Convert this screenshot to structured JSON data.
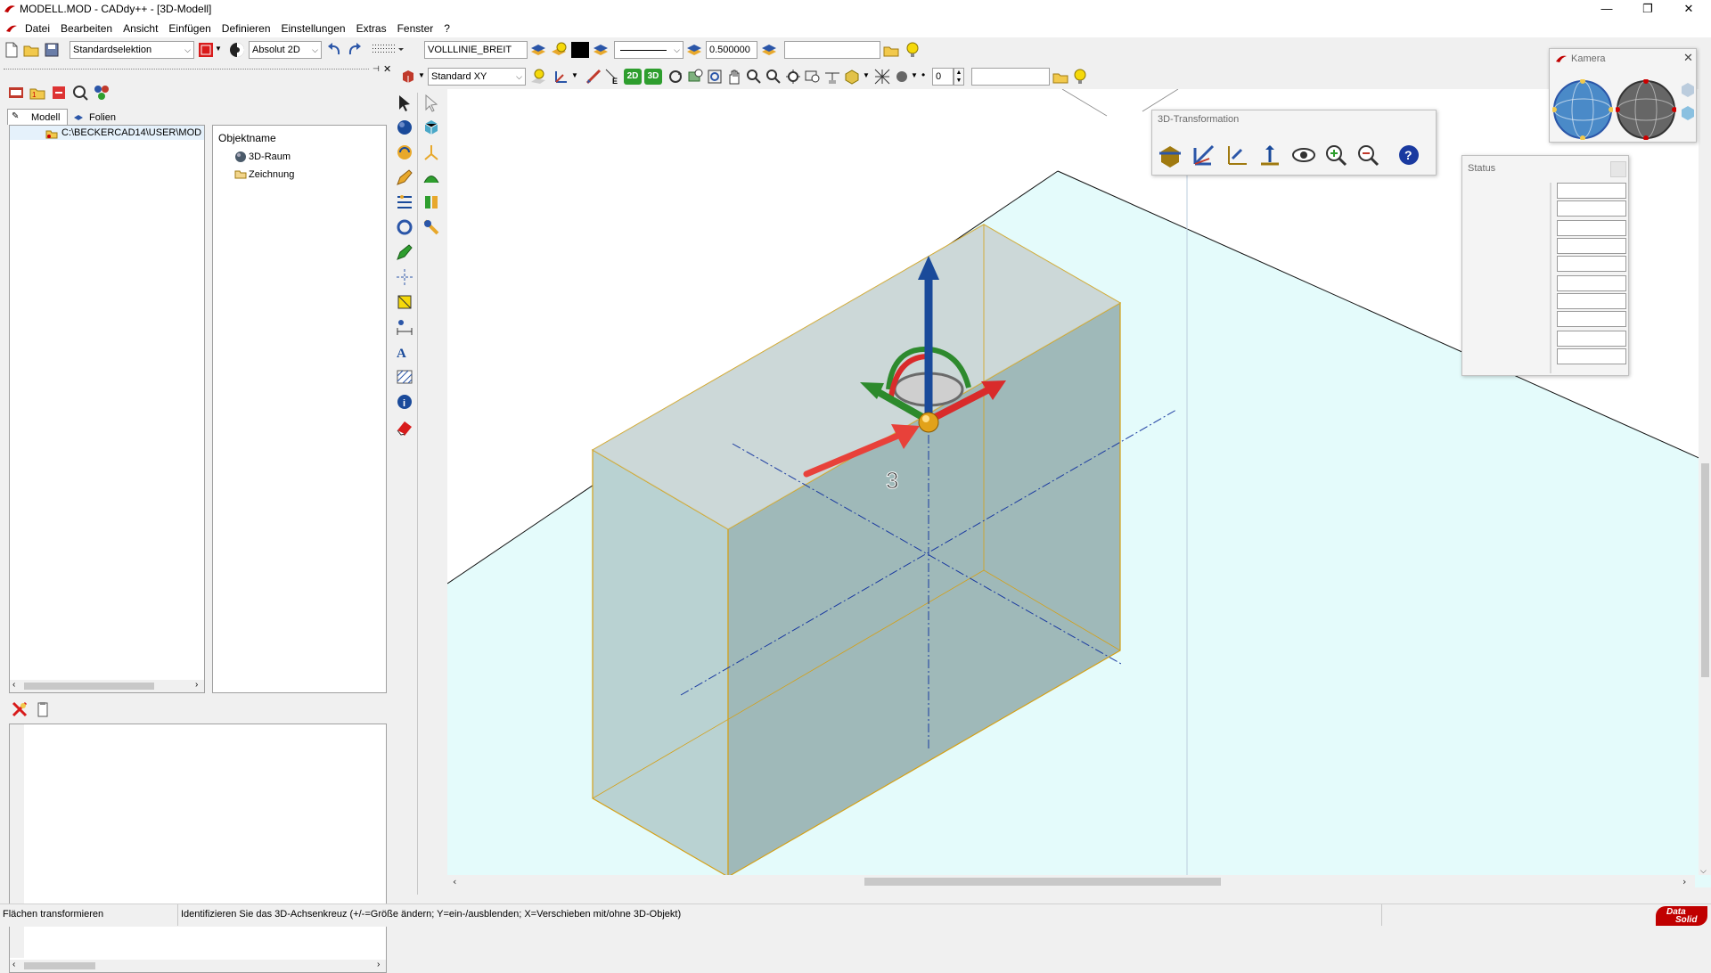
{
  "window": {
    "title": "MODELL.MOD  -  CADdy++ - [3D-Modell]",
    "minimize": "—",
    "maximize": "❐",
    "close": "✕"
  },
  "menu": [
    "Datei",
    "Bearbeiten",
    "Ansicht",
    "Einfügen",
    "Definieren",
    "Einstellungen",
    "Extras",
    "Fenster",
    "?"
  ],
  "mdi": {
    "minimize": "–",
    "restore": "❐",
    "close": "✕"
  },
  "toolbar1": {
    "selection_mode": "Standardselektion",
    "coord_mode": "Absolut 2D",
    "linetype": "VOLLLINIE_BREIT",
    "linewidth": "0.500000",
    "layer_field": ""
  },
  "toolbar2": {
    "view_plane": "Standard XY",
    "label_2d": "2D",
    "label_3d": "3D",
    "spin_value": "0",
    "text_field": ""
  },
  "left_panel": {
    "tabs": [
      "Modell",
      "Folien"
    ],
    "tree_path": "C:\\BECKERCAD14\\USER\\MOD",
    "column_header": "Objektname",
    "objects": [
      "3D-Raum",
      "Zeichnung"
    ]
  },
  "floating": {
    "transform_title": "3D-Transformation",
    "camera_title": "Kamera",
    "status_title": "Status",
    "status_rows": 10
  },
  "annotation": {
    "label": "3"
  },
  "statusbar": {
    "command": "Flächen transformieren",
    "hint": "Identifizieren Sie das 3D-Achsenkreuz (+/-=Größe ändern; Y=ein-/ausblenden; X=Verschieben mit/ohne 3D-Objekt)",
    "logo_line1": "Data",
    "logo_line2": "Solid"
  },
  "colors": {
    "viewport_bg": "#e4fbfb",
    "box_edge": "#d4a017",
    "axis_x": "#d92b2b",
    "axis_y": "#2c8a2c",
    "axis_z": "#1a4a9a",
    "arrow": "#e8413a",
    "brand": "#c00000"
  },
  "icons": [
    "new-file-icon",
    "open-folder-icon",
    "save-icon",
    "undo-icon",
    "redo-icon",
    "pointer-icon",
    "sphere-icon",
    "pencil-icon",
    "info-icon",
    "eraser-icon",
    "camera-icon",
    "help-icon",
    "zoom-in-icon",
    "zoom-out-icon",
    "eye-icon",
    "pan-hand-icon"
  ]
}
